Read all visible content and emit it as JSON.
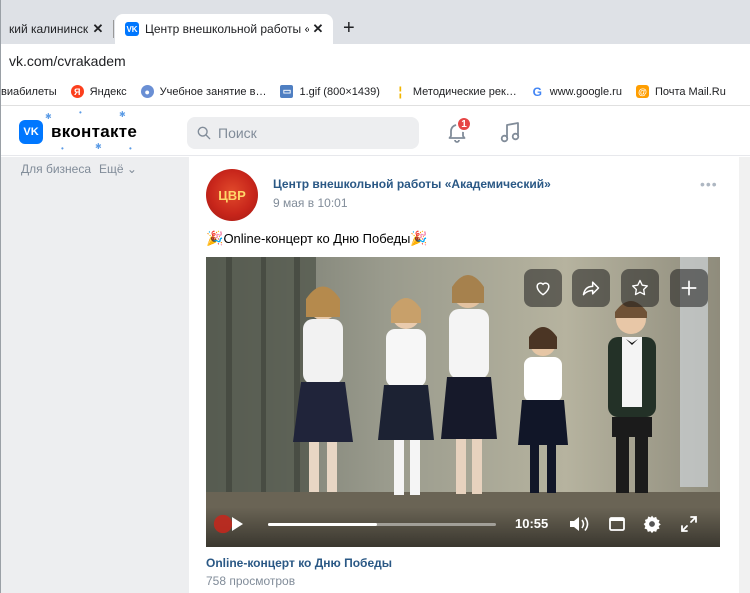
{
  "browser": {
    "tabs": [
      {
        "title": "кий калининск…",
        "active": false
      },
      {
        "title": "Центр внешкольной работы «А",
        "active": true
      }
    ],
    "new_tab": "+",
    "url": "vk.com/cvrakadem",
    "bookmarks": [
      {
        "label": "виабилеты",
        "icon": ""
      },
      {
        "label": "Яндекс",
        "icon": "yandex-icon"
      },
      {
        "label": "Учебное занятие в…",
        "icon": "globe-icon"
      },
      {
        "label": "1.gif (800×1439)",
        "icon": "image-icon"
      },
      {
        "label": "Методические рек…",
        "icon": "doc-icon"
      },
      {
        "label": "www.google.ru",
        "icon": "google-icon"
      },
      {
        "label": "Почта Mail.Ru",
        "icon": "mail-icon"
      }
    ]
  },
  "vk": {
    "logo_text": "вконтакте",
    "search_placeholder": "Поиск",
    "notif_count": "1",
    "sidebar": {
      "business": "Для бизнеса",
      "more": "Ещё ⌄"
    }
  },
  "post": {
    "avatar_text": "ЦВР",
    "author": "Центр внешкольной работы «Академический»",
    "date": "9 мая в 10:01",
    "more": "•••",
    "text": "Online-концерт ко Дню Победы",
    "emoji": "🎉",
    "video": {
      "time": "10:55",
      "progress": 0.48,
      "title": "Online-концерт ко Дню Победы",
      "views": "758 просмотров"
    }
  },
  "colors": {
    "vk_blue": "#0077ff",
    "link": "#2a5885",
    "badge": "#e64646"
  }
}
